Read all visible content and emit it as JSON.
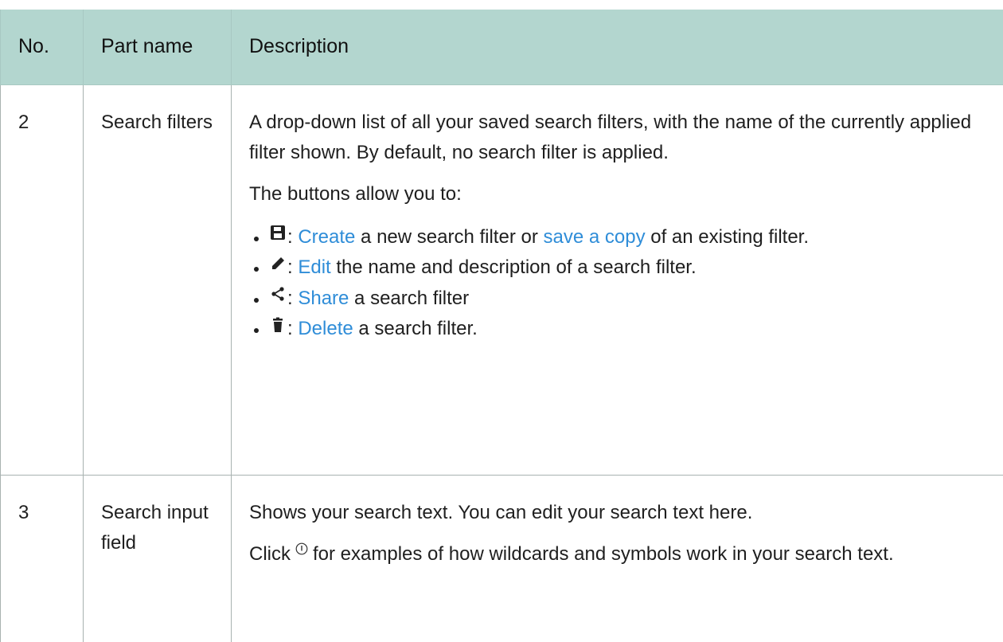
{
  "header": {
    "col_no": "No.",
    "col_part": "Part name",
    "col_desc": "Description"
  },
  "rows": [
    {
      "no": "2",
      "part": "Search filters",
      "desc_para1": "A drop-down list of all your saved search filters, with the name of the currently applied filter shown. By default, no search filter is applied.",
      "desc_para2": "The buttons allow you to:",
      "bullets": [
        {
          "icon": "floppy-disk-icon",
          "sep": ": ",
          "link1": "Create",
          "text1": " a new search filter or ",
          "link2": "save a copy",
          "text2": " of an existing filter."
        },
        {
          "icon": "pencil-icon",
          "sep": ": ",
          "link1": "Edit",
          "text1": " the name and description of a search filter."
        },
        {
          "icon": "share-icon",
          "sep": ": ",
          "link1": "Share",
          "text1": " a search filter"
        },
        {
          "icon": "trash-icon",
          "sep": ": ",
          "link1": "Delete",
          "text1": " a search filter."
        }
      ]
    },
    {
      "no": "3",
      "part": "Search input field",
      "desc_para1": "Shows your search text. You can edit your search text here.",
      "desc_para2_before": "Click",
      "desc_para2_icon": "info-icon",
      "desc_para2_after": "for examples of how wildcards and symbols work in your search text."
    }
  ],
  "colors": {
    "header_bg": "#b3d6cf",
    "link": "#2f8dd8"
  }
}
